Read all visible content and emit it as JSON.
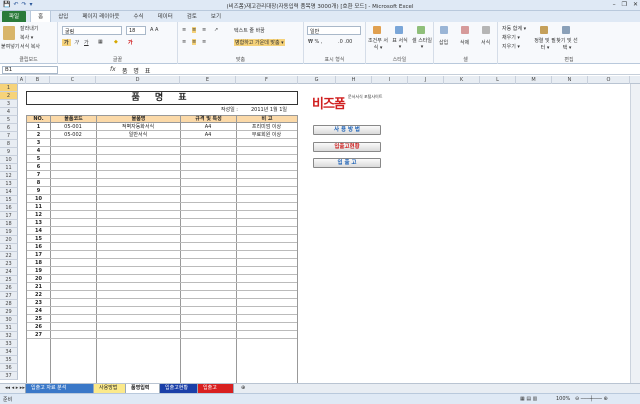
{
  "window": {
    "title": "(비즈폼)재고관리대장(자동입력 품목명 3000개) [호환 모드] - Microsoft Excel",
    "qat": [
      "💾",
      "↶",
      "↷",
      "▾"
    ],
    "controls": [
      "–",
      "❐",
      "✕"
    ]
  },
  "ribbon_tabs": [
    "파일",
    "홈",
    "삽입",
    "페이지 레이아웃",
    "수식",
    "데이터",
    "검토",
    "보기"
  ],
  "ribbon": {
    "clipboard": {
      "paste": "붙여넣기",
      "cut": "잘라내기",
      "copy": "복사 ▾",
      "format_painter": "서식 복사",
      "label": "클립보드"
    },
    "font": {
      "name": "굴림",
      "size": "18",
      "label": "글꼴"
    },
    "alignment": {
      "wrap": "텍스트 줄 바꿈",
      "merge": "병합하고 가운데 맞춤 ▾",
      "label": "맞춤"
    },
    "number": {
      "format": "일반",
      "label": "표시 형식"
    },
    "styles": {
      "conditional": "조건부 서식 ▾",
      "table": "표 서식 ▾",
      "cell": "셀 스타일 ▾",
      "label": "스타일"
    },
    "cells": {
      "insert": "삽입",
      "delete": "삭제",
      "format": "서식",
      "label": "셀"
    },
    "editing": {
      "autosum": "자동 합계 ▾",
      "fill": "채우기 ▾",
      "clear": "지우기 ▾",
      "sort": "정렬 및 필터 ▾",
      "find": "찾기 및 선택 ▾",
      "label": "편집"
    }
  },
  "formula_bar": {
    "name_box": "B1",
    "fx": "fx",
    "value": "품 명 표"
  },
  "columns": [
    "A",
    "B",
    "C",
    "D",
    "E",
    "F",
    "G",
    "H",
    "I",
    "J",
    "K",
    "L",
    "M",
    "N",
    "O"
  ],
  "sheet": {
    "title": "품 명 표",
    "date_label": "작성일 :",
    "date_value": "2011년 1월 1일",
    "headers": [
      "NO.",
      "물품코드",
      "물품명",
      "규격 및 특성",
      "비 고"
    ],
    "rows": [
      [
        "1",
        "05-001",
        "적벽자동화서식",
        "A4",
        "프리미엄 이상"
      ],
      [
        "2",
        "05-002",
        "일반서식",
        "A4",
        "무료회원 이상"
      ],
      [
        "3",
        "",
        "",
        "",
        ""
      ],
      [
        "4",
        "",
        "",
        "",
        ""
      ],
      [
        "5",
        "",
        "",
        "",
        ""
      ],
      [
        "6",
        "",
        "",
        "",
        ""
      ],
      [
        "7",
        "",
        "",
        "",
        ""
      ],
      [
        "8",
        "",
        "",
        "",
        ""
      ],
      [
        "9",
        "",
        "",
        "",
        ""
      ],
      [
        "10",
        "",
        "",
        "",
        ""
      ],
      [
        "11",
        "",
        "",
        "",
        ""
      ],
      [
        "12",
        "",
        "",
        "",
        ""
      ],
      [
        "13",
        "",
        "",
        "",
        ""
      ],
      [
        "14",
        "",
        "",
        "",
        ""
      ],
      [
        "15",
        "",
        "",
        "",
        ""
      ],
      [
        "16",
        "",
        "",
        "",
        ""
      ],
      [
        "17",
        "",
        "",
        "",
        ""
      ],
      [
        "18",
        "",
        "",
        "",
        ""
      ],
      [
        "19",
        "",
        "",
        "",
        ""
      ],
      [
        "20",
        "",
        "",
        "",
        ""
      ],
      [
        "21",
        "",
        "",
        "",
        ""
      ],
      [
        "22",
        "",
        "",
        "",
        ""
      ],
      [
        "23",
        "",
        "",
        "",
        ""
      ],
      [
        "24",
        "",
        "",
        "",
        ""
      ],
      [
        "25",
        "",
        "",
        "",
        ""
      ],
      [
        "26",
        "",
        "",
        "",
        ""
      ],
      [
        "27",
        "",
        "",
        "",
        ""
      ]
    ]
  },
  "logo": {
    "text": "비즈폼",
    "tagline": "문서서식 포털사이트"
  },
  "side_buttons": [
    "사 용 방 법",
    "입출고현황",
    "입 출 고"
  ],
  "side_button_colors": [
    "#1a5fb4",
    "#cc1c1c",
    "#1a5fb4"
  ],
  "sheet_tabs": [
    "입출고 자료 분석",
    "사용방법",
    "품명입력",
    "입출고현황",
    "입출고"
  ],
  "status": {
    "ready": "준비",
    "zoom": "100%"
  }
}
